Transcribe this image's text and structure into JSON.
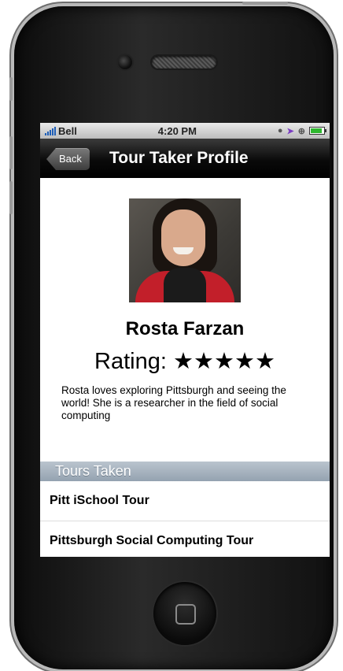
{
  "status_bar": {
    "carrier": "Bell",
    "time": "4:20 PM"
  },
  "nav": {
    "back_label": "Back",
    "title": "Tour Taker Profile"
  },
  "profile": {
    "name": "Rosta Farzan",
    "rating_text": "Rating: ★★★★★",
    "rating_stars": 5,
    "bio": "Rosta loves exploring Pittsburgh and seeing the world! She is a researcher in the field of social computing"
  },
  "tours": {
    "header": "Tours Taken",
    "items": [
      {
        "label": "Pitt iSchool Tour"
      },
      {
        "label": "Pittsburgh Social Computing Tour"
      }
    ]
  },
  "colors": {
    "navbar": "#000000",
    "section_header": "#a3afbb",
    "jacket": "#c21f2a"
  },
  "icons": [
    "signal-icon",
    "location-arrow-icon",
    "lock-rotation-icon",
    "battery-icon",
    "home-button-icon"
  ]
}
